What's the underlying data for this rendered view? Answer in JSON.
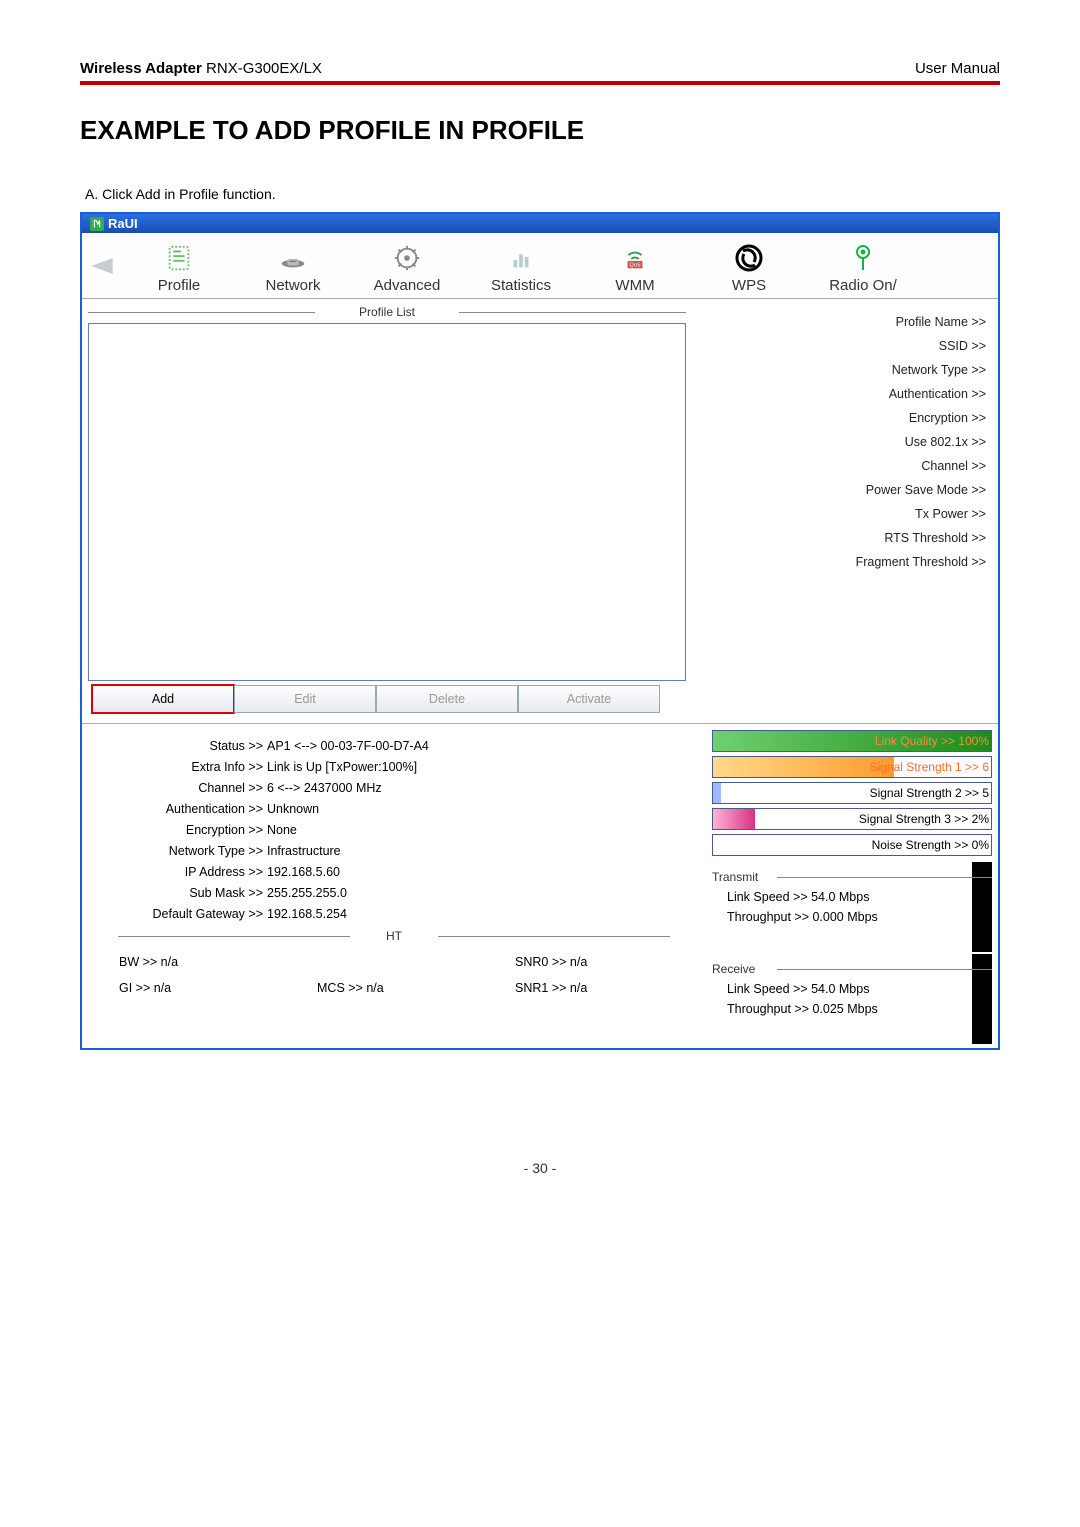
{
  "doc_header": {
    "bold": "Wireless Adapter",
    "model": " RNX-G300EX/LX",
    "right": "User Manual"
  },
  "section_title": "EXAMPLE TO ADD PROFILE IN PROFILE",
  "instruction": "A. Click Add in Profile function.",
  "window_title": "RaUI",
  "toolbar": {
    "profile": "Profile",
    "network": "Network",
    "advanced": "Advanced",
    "statistics": "Statistics",
    "wmm": "WMM",
    "wps": "WPS",
    "radio": "Radio On/"
  },
  "profile_list_title": "Profile List",
  "details": {
    "profile_name": "Profile Name >>",
    "ssid": "SSID >>",
    "network_type": "Network Type >>",
    "authentication": "Authentication >>",
    "encryption": "Encryption >>",
    "use8021x": "Use 802.1x >>",
    "channel": "Channel >>",
    "psm": "Power Save Mode >>",
    "tx_power": "Tx Power >>",
    "rts": "RTS Threshold >>",
    "frag": "Fragment Threshold >>"
  },
  "buttons": {
    "add": "Add",
    "edit": "Edit",
    "delete": "Delete",
    "activate": "Activate"
  },
  "status": {
    "status_l": "Status >>",
    "status_v": "AP1 <--> 00-03-7F-00-D7-A4",
    "extra_l": "Extra Info >>",
    "extra_v": "Link is Up [TxPower:100%]",
    "channel_l": "Channel >>",
    "channel_v": "6 <--> 2437000 MHz",
    "auth_l": "Authentication >>",
    "auth_v": "Unknown",
    "enc_l": "Encryption >>",
    "enc_v": "None",
    "net_l": "Network Type >>",
    "net_v": "Infrastructure",
    "ip_l": "IP Address >>",
    "ip_v": "192.168.5.60",
    "sub_l": "Sub Mask >>",
    "sub_v": "255.255.255.0",
    "gw_l": "Default Gateway >>",
    "gw_v": "192.168.5.254"
  },
  "ht_title": "HT",
  "ht": {
    "bw": "BW >> n/a",
    "snr0": "SNR0 >> n/a",
    "gi": "GI >> n/a",
    "mcs": "MCS >> n/a",
    "snr1": "SNR1 >> n/a"
  },
  "bars": {
    "lq": "Link Quality >> 100%",
    "s1": "Signal Strength 1 >> 6",
    "s2": "Signal Strength 2 >> 5",
    "s3": "Signal Strength 3 >> 2%",
    "ns": "Noise Strength >> 0%"
  },
  "tr": {
    "transmit": "Transmit",
    "t_ls": "Link Speed >> 54.0 Mbps",
    "t_tp": "Throughput >> 0.000 Mbps",
    "receive": "Receive",
    "r_ls": "Link Speed >> 54.0 Mbps",
    "r_tp": "Throughput >> 0.025 Mbps"
  },
  "page_num": "- 30 -"
}
